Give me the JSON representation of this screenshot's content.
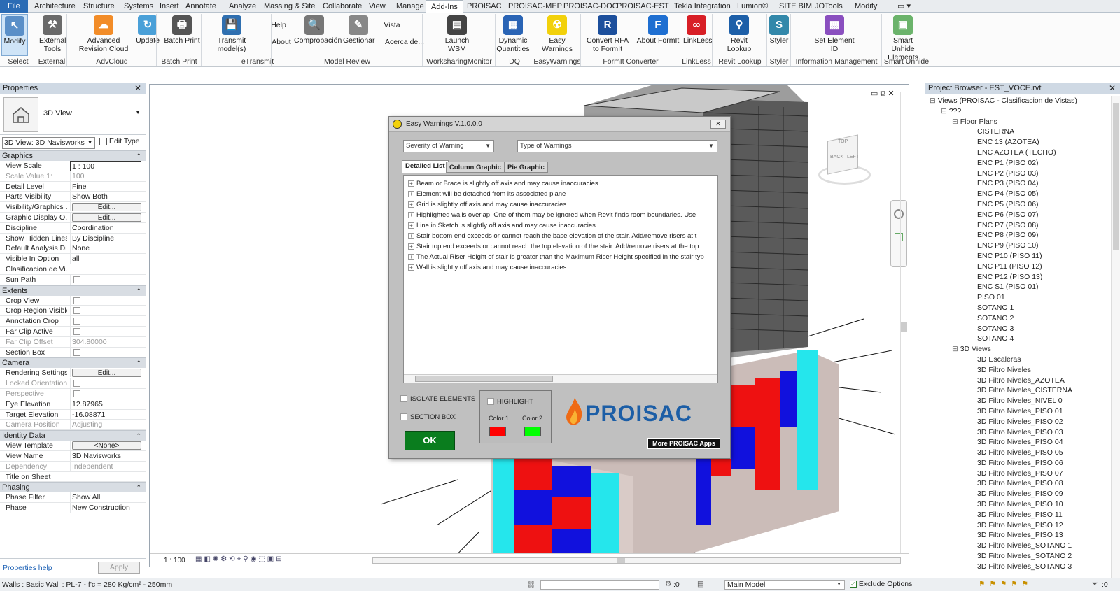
{
  "tabs": [
    "File",
    "Architecture",
    "Structure",
    "Systems",
    "Insert",
    "Annotate",
    "Analyze",
    "Massing & Site",
    "Collaborate",
    "View",
    "Manage",
    "Add-Ins",
    "PROISAC",
    "PROISAC-MEP",
    "PROISAC-DOC",
    "PROISAC-EST",
    "Tekla Integration",
    "Lumion®",
    "SITE BIM",
    "JOTools",
    "Modify"
  ],
  "ribbon": {
    "buttons": [
      "Modify",
      "External Tools",
      "Advanced Revision Cloud",
      "Update",
      "Batch Print",
      "Transmit model(s)",
      "Help",
      "About",
      "Comprobación",
      "Gestionar",
      "Vista",
      "Acerca de...",
      "Launch WSM",
      "Dynamic Quantities",
      "Easy Warnings",
      "Convert RFA to FormIt",
      "About FormIt",
      "LinkLess",
      "Revit Lookup",
      "Styler",
      "Set Element ID",
      "Smart Unhide Elements"
    ],
    "panels": [
      "Select",
      "External",
      "AdvCloud",
      "Batch Print",
      "eTransmit",
      "Model Review",
      "WorksharingMonitor",
      "DQ",
      "EasyWarnings",
      "FormIt Converter",
      "LinkLess",
      "Revit Lookup",
      "Styler",
      "Information Management",
      "Smart Unhide"
    ]
  },
  "properties": {
    "title": "Properties",
    "type_name": "3D View",
    "view_select": "3D View: 3D Navisworks",
    "edit_type": "Edit Type",
    "groups": [
      {
        "name": "Graphics",
        "rows": [
          [
            "View Scale",
            "1 : 100"
          ],
          [
            "Scale Value    1:",
            "100"
          ],
          [
            "Detail Level",
            "Fine"
          ],
          [
            "Parts Visibility",
            "Show Both"
          ],
          [
            "Visibility/Graphics ...",
            "Edit..."
          ],
          [
            "Graphic Display O...",
            "Edit..."
          ],
          [
            "Discipline",
            "Coordination"
          ],
          [
            "Show Hidden Lines",
            "By Discipline"
          ],
          [
            "Default Analysis Di...",
            "None"
          ],
          [
            "Visible In Option",
            "all"
          ],
          [
            "Clasificacion de Vi...",
            ""
          ],
          [
            "Sun Path",
            ""
          ]
        ]
      },
      {
        "name": "Extents",
        "rows": [
          [
            "Crop View",
            ""
          ],
          [
            "Crop Region Visible",
            ""
          ],
          [
            "Annotation Crop",
            ""
          ],
          [
            "Far Clip Active",
            ""
          ],
          [
            "Far Clip Offset",
            "304.80000"
          ],
          [
            "Section Box",
            ""
          ]
        ]
      },
      {
        "name": "Camera",
        "rows": [
          [
            "Rendering Settings",
            "Edit..."
          ],
          [
            "Locked Orientation",
            ""
          ],
          [
            "Perspective",
            ""
          ],
          [
            "Eye Elevation",
            "12.87965"
          ],
          [
            "Target Elevation",
            "-16.08871"
          ],
          [
            "Camera Position",
            "Adjusting"
          ]
        ]
      },
      {
        "name": "Identity Data",
        "rows": [
          [
            "View Template",
            "<None>"
          ],
          [
            "View Name",
            "3D Navisworks"
          ],
          [
            "Dependency",
            "Independent"
          ],
          [
            "Title on Sheet",
            ""
          ]
        ]
      },
      {
        "name": "Phasing",
        "rows": [
          [
            "Phase Filter",
            "Show All"
          ],
          [
            "Phase",
            "New Construction"
          ]
        ]
      }
    ],
    "help_link": "Properties help",
    "apply": "Apply"
  },
  "dialog": {
    "title": "Easy Warnings V.1.0.0.0",
    "severity": "Severity of Warning",
    "type": "Type of Warnings",
    "tabs": [
      "Detailed List",
      "Column Graphic",
      "Pie Graphic"
    ],
    "warnings": [
      "Beam or Brace is slightly off axis and may cause inaccuracies.",
      "Element will be detached from its associated plane",
      "Grid is slightly off axis and may cause inaccuracies.",
      "Highlighted walls overlap. One of them may be ignored when Revit finds room boundaries. Use",
      "Line in Sketch is slightly off axis and may cause inaccuracies.",
      "Stair bottom end exceeds or cannot reach the base elevation of the stair. Add/remove risers at t",
      "Stair top end exceeds or cannot reach the top elevation of the stair. Add/remove risers at the top",
      "The Actual Riser Height of stair is greater than the Maximum Riser Height specified in the stair typ",
      "Wall is slightly off axis and may cause inaccuracies."
    ],
    "isolate": "ISOLATE ELEMENTS",
    "section_box": "SECTION BOX",
    "highlight": "HIGHLIGHT",
    "color1": "Color 1",
    "color2": "Color 2",
    "ok": "OK",
    "logo": "PROISAC",
    "more": "More PROISAC Apps"
  },
  "viewcube": {
    "top": "TOP",
    "back": "BACK",
    "left": "LEFT"
  },
  "browser": {
    "title": "Project Browser - EST_VOCE.rvt",
    "root": "Views (PROISAC - Clasificacion de Vistas)",
    "unknown": "???",
    "floor_plans": "Floor Plans",
    "plans": [
      "CISTERNA",
      "ENC 13 (AZOTEA)",
      "ENC AZOTEA (TECHO)",
      "ENC P1 (PISO 02)",
      "ENC P2 (PISO 03)",
      "ENC P3 (PISO 04)",
      "ENC P4 (PISO 05)",
      "ENC P5 (PISO 06)",
      "ENC P6 (PISO 07)",
      "ENC P7 (PISO 08)",
      "ENC P8 (PISO 09)",
      "ENC P9 (PISO 10)",
      "ENC P10 (PISO 11)",
      "ENC P11 (PISO 12)",
      "ENC P12 (PISO 13)",
      "ENC S1 (PISO 01)",
      "PISO 01",
      "SOTANO 1",
      "SOTANO 2",
      "SOTANO 3",
      "SOTANO 4"
    ],
    "views_3d": "3D Views",
    "views": [
      "3D Escaleras",
      "3D Filtro Niveles",
      "3D Filtro Niveles_AZOTEA",
      "3D Filtro Niveles_CISTERNA",
      "3D Filtro Niveles_NIVEL 0",
      "3D Filtro Niveles_PISO 01",
      "3D Filtro Niveles_PISO 02",
      "3D Filtro Niveles_PISO 03",
      "3D Filtro Niveles_PISO 04",
      "3D Filtro Niveles_PISO 05",
      "3D Filtro Niveles_PISO 06",
      "3D Filtro Niveles_PISO 07",
      "3D Filtro Niveles_PISO 08",
      "3D Filtro Niveles_PISO 09",
      "3D Filtro Niveles_PISO 10",
      "3D Filtro Niveles_PISO 11",
      "3D Filtro Niveles_PISO 12",
      "3D Filtro Niveles_PISO 13",
      "3D Filtro Niveles_SOTANO 1",
      "3D Filtro Niveles_SOTANO 2",
      "3D Filtro Niveles_SOTANO 3"
    ]
  },
  "view_scale": "1 : 100",
  "status": {
    "left": "Walls : Basic Wall : PL-7 - f'c = 280 Kg/cm² - 250mm",
    "coord": ":0",
    "model": "Main Model",
    "exclude": "Exclude Options",
    "filter": ":0"
  },
  "colors": {
    "accent": "#2b6cb5",
    "highlight1": "#ff0000",
    "highlight2": "#00ff00",
    "ok": "#0a7d1e"
  }
}
